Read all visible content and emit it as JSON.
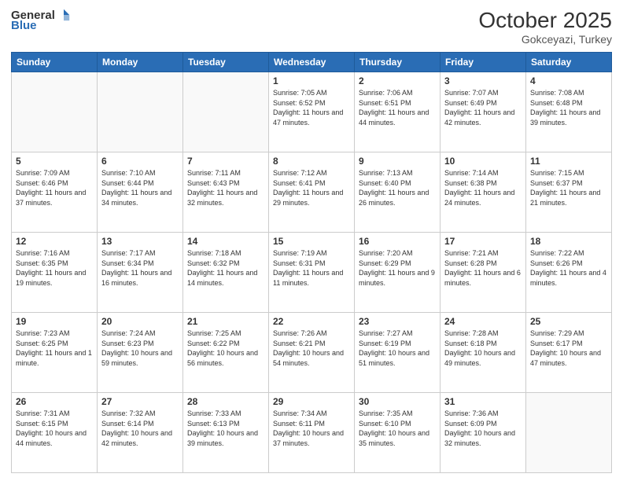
{
  "header": {
    "logo_general": "General",
    "logo_blue": "Blue",
    "month": "October 2025",
    "location": "Gokceyazi, Turkey"
  },
  "days_of_week": [
    "Sunday",
    "Monday",
    "Tuesday",
    "Wednesday",
    "Thursday",
    "Friday",
    "Saturday"
  ],
  "weeks": [
    [
      {
        "day": "",
        "info": ""
      },
      {
        "day": "",
        "info": ""
      },
      {
        "day": "",
        "info": ""
      },
      {
        "day": "1",
        "info": "Sunrise: 7:05 AM\nSunset: 6:52 PM\nDaylight: 11 hours and 47 minutes."
      },
      {
        "day": "2",
        "info": "Sunrise: 7:06 AM\nSunset: 6:51 PM\nDaylight: 11 hours and 44 minutes."
      },
      {
        "day": "3",
        "info": "Sunrise: 7:07 AM\nSunset: 6:49 PM\nDaylight: 11 hours and 42 minutes."
      },
      {
        "day": "4",
        "info": "Sunrise: 7:08 AM\nSunset: 6:48 PM\nDaylight: 11 hours and 39 minutes."
      }
    ],
    [
      {
        "day": "5",
        "info": "Sunrise: 7:09 AM\nSunset: 6:46 PM\nDaylight: 11 hours and 37 minutes."
      },
      {
        "day": "6",
        "info": "Sunrise: 7:10 AM\nSunset: 6:44 PM\nDaylight: 11 hours and 34 minutes."
      },
      {
        "day": "7",
        "info": "Sunrise: 7:11 AM\nSunset: 6:43 PM\nDaylight: 11 hours and 32 minutes."
      },
      {
        "day": "8",
        "info": "Sunrise: 7:12 AM\nSunset: 6:41 PM\nDaylight: 11 hours and 29 minutes."
      },
      {
        "day": "9",
        "info": "Sunrise: 7:13 AM\nSunset: 6:40 PM\nDaylight: 11 hours and 26 minutes."
      },
      {
        "day": "10",
        "info": "Sunrise: 7:14 AM\nSunset: 6:38 PM\nDaylight: 11 hours and 24 minutes."
      },
      {
        "day": "11",
        "info": "Sunrise: 7:15 AM\nSunset: 6:37 PM\nDaylight: 11 hours and 21 minutes."
      }
    ],
    [
      {
        "day": "12",
        "info": "Sunrise: 7:16 AM\nSunset: 6:35 PM\nDaylight: 11 hours and 19 minutes."
      },
      {
        "day": "13",
        "info": "Sunrise: 7:17 AM\nSunset: 6:34 PM\nDaylight: 11 hours and 16 minutes."
      },
      {
        "day": "14",
        "info": "Sunrise: 7:18 AM\nSunset: 6:32 PM\nDaylight: 11 hours and 14 minutes."
      },
      {
        "day": "15",
        "info": "Sunrise: 7:19 AM\nSunset: 6:31 PM\nDaylight: 11 hours and 11 minutes."
      },
      {
        "day": "16",
        "info": "Sunrise: 7:20 AM\nSunset: 6:29 PM\nDaylight: 11 hours and 9 minutes."
      },
      {
        "day": "17",
        "info": "Sunrise: 7:21 AM\nSunset: 6:28 PM\nDaylight: 11 hours and 6 minutes."
      },
      {
        "day": "18",
        "info": "Sunrise: 7:22 AM\nSunset: 6:26 PM\nDaylight: 11 hours and 4 minutes."
      }
    ],
    [
      {
        "day": "19",
        "info": "Sunrise: 7:23 AM\nSunset: 6:25 PM\nDaylight: 11 hours and 1 minute."
      },
      {
        "day": "20",
        "info": "Sunrise: 7:24 AM\nSunset: 6:23 PM\nDaylight: 10 hours and 59 minutes."
      },
      {
        "day": "21",
        "info": "Sunrise: 7:25 AM\nSunset: 6:22 PM\nDaylight: 10 hours and 56 minutes."
      },
      {
        "day": "22",
        "info": "Sunrise: 7:26 AM\nSunset: 6:21 PM\nDaylight: 10 hours and 54 minutes."
      },
      {
        "day": "23",
        "info": "Sunrise: 7:27 AM\nSunset: 6:19 PM\nDaylight: 10 hours and 51 minutes."
      },
      {
        "day": "24",
        "info": "Sunrise: 7:28 AM\nSunset: 6:18 PM\nDaylight: 10 hours and 49 minutes."
      },
      {
        "day": "25",
        "info": "Sunrise: 7:29 AM\nSunset: 6:17 PM\nDaylight: 10 hours and 47 minutes."
      }
    ],
    [
      {
        "day": "26",
        "info": "Sunrise: 7:31 AM\nSunset: 6:15 PM\nDaylight: 10 hours and 44 minutes."
      },
      {
        "day": "27",
        "info": "Sunrise: 7:32 AM\nSunset: 6:14 PM\nDaylight: 10 hours and 42 minutes."
      },
      {
        "day": "28",
        "info": "Sunrise: 7:33 AM\nSunset: 6:13 PM\nDaylight: 10 hours and 39 minutes."
      },
      {
        "day": "29",
        "info": "Sunrise: 7:34 AM\nSunset: 6:11 PM\nDaylight: 10 hours and 37 minutes."
      },
      {
        "day": "30",
        "info": "Sunrise: 7:35 AM\nSunset: 6:10 PM\nDaylight: 10 hours and 35 minutes."
      },
      {
        "day": "31",
        "info": "Sunrise: 7:36 AM\nSunset: 6:09 PM\nDaylight: 10 hours and 32 minutes."
      },
      {
        "day": "",
        "info": ""
      }
    ]
  ]
}
